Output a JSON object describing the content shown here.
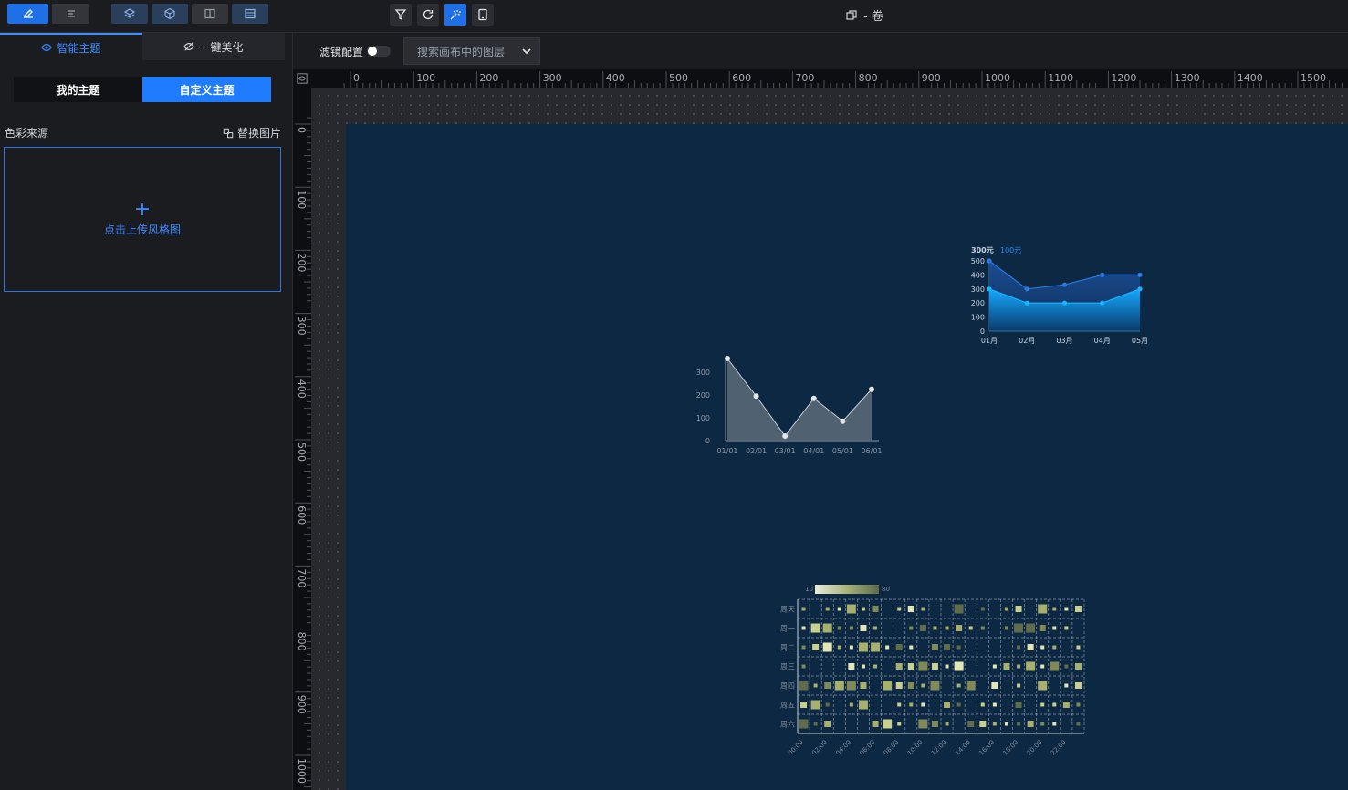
{
  "app": {
    "title": "- 卷"
  },
  "left_panel": {
    "tabs": [
      {
        "label": "智能主题"
      },
      {
        "label": "一键美化"
      }
    ],
    "sub_tabs": [
      {
        "label": "我的主题"
      },
      {
        "label": "自定义主题"
      }
    ],
    "color_source_label": "色彩来源",
    "replace_image_label": "替换图片",
    "upload_plus": "+",
    "upload_label": "点击上传风格图"
  },
  "toolbar": {
    "filter_label": "滤镜配置",
    "filter_enabled": false,
    "layer_search_placeholder": "搜索画布中的图层"
  },
  "rulers": {
    "h_labels": [
      "0",
      "100",
      "200",
      "300",
      "400",
      "500",
      "600",
      "700",
      "800",
      "900",
      "1000",
      "1100",
      "1200",
      "1300",
      "1400",
      "1500"
    ],
    "v_labels": [
      "0",
      "100",
      "200",
      "300",
      "400",
      "500",
      "600",
      "700",
      "800",
      "900",
      "1000"
    ]
  },
  "colors": {
    "accent": "#1f7cff",
    "screen_bg": "#0d2843"
  },
  "chart_data": [
    {
      "type": "area",
      "categories": [
        "01/01",
        "02/01",
        "03/01",
        "04/01",
        "05/01",
        "06/01"
      ],
      "series": [
        {
          "values": [
            360,
            195,
            20,
            185,
            85,
            225
          ]
        }
      ],
      "yticks": [
        "0",
        "100",
        "200",
        "300"
      ],
      "ylim": [
        0,
        360
      ]
    },
    {
      "type": "area",
      "categories": [
        "01月",
        "02月",
        "03月",
        "04月",
        "05月"
      ],
      "series": [
        {
          "name": "300元",
          "values": [
            500,
            300,
            330,
            400,
            400
          ]
        },
        {
          "name": "100元",
          "values": [
            300,
            200,
            200,
            200,
            300
          ]
        }
      ],
      "yticks": [
        "0",
        "100",
        "200",
        "300",
        "400",
        "500"
      ],
      "ylim": [
        0,
        500
      ],
      "legend": "top-left"
    },
    {
      "type": "heatmap",
      "x_labels": [
        "00:00",
        "02:00",
        "04:00",
        "06:00",
        "08:00",
        "10:00",
        "12:00",
        "14:00",
        "16:00",
        "18:00",
        "20:00",
        "22:00"
      ],
      "y_labels": [
        "周天",
        "周一",
        "周二",
        "周三",
        "周四",
        "周五",
        "周六"
      ],
      "visual_map": {
        "min_label": "10",
        "max_label": "80"
      }
    }
  ]
}
